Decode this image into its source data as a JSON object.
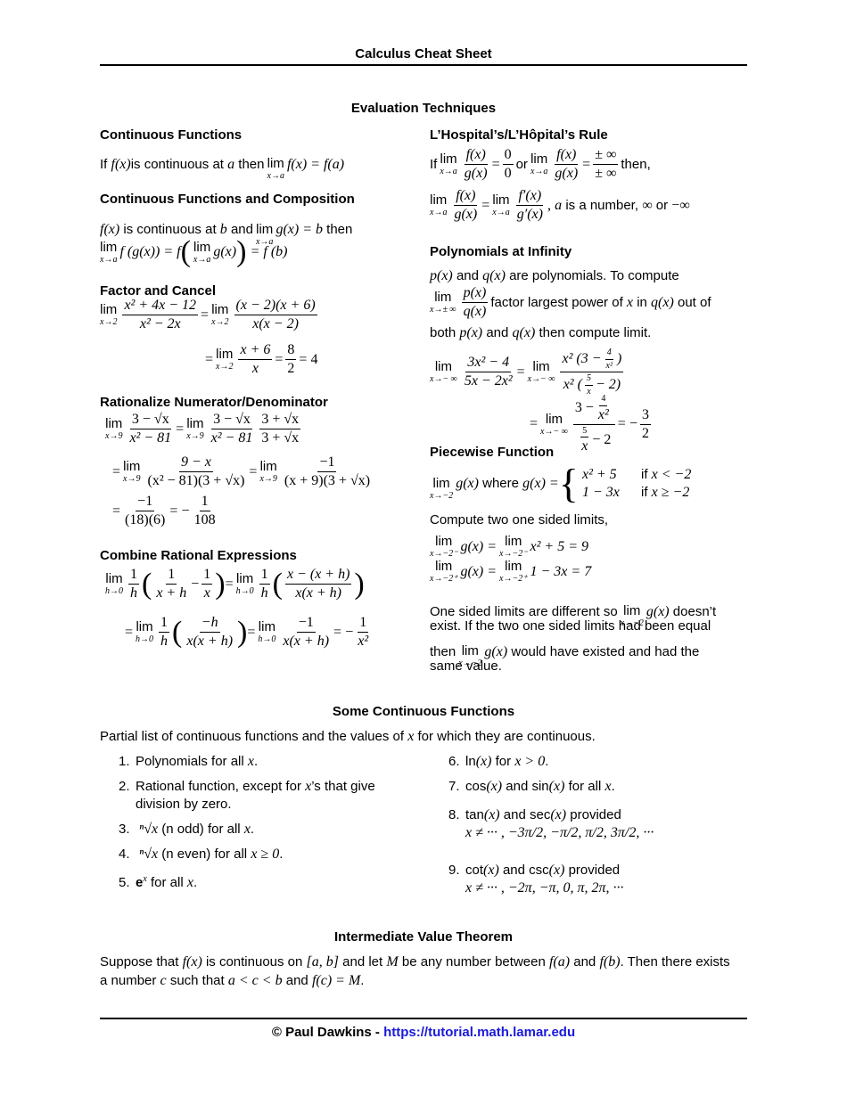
{
  "header": {
    "title": "Calculus Cheat Sheet"
  },
  "section_evaluation": {
    "title": "Evaluation Techniques",
    "continuous_functions": {
      "title": "Continuous Functions",
      "text_if": "If",
      "f_x": "f(x)",
      "text_mid": "is continuous at",
      "a": "a",
      "text_then": "then",
      "lim": "lim",
      "lim_sub": "x→a",
      "expr": "f(x) = f(a)"
    },
    "composition": {
      "title": "Continuous Functions and Composition",
      "f_x": "f(x)",
      "text1": "is continuous at",
      "b": "b",
      "text2": "and",
      "lim": "lim",
      "lim_sub": "x→a",
      "gx_eq_b": "g(x) = b",
      "text3": "then",
      "line2_left": "f (g(x)) = f",
      "line2_inner": "g(x)",
      "line2_right": "= f (b)"
    },
    "factor_cancel": {
      "title": "Factor and Cancel",
      "lim": "lim",
      "lim_sub": "x→2",
      "frac1_num": "x² + 4x − 12",
      "frac1_den": "x² − 2x",
      "frac2_num": "(x − 2)(x + 6)",
      "frac2_den": "x(x − 2)",
      "frac3_num": "x + 6",
      "frac3_den": "x",
      "frac4_num": "8",
      "frac4_den": "2",
      "result": "= 4",
      "eq": "="
    },
    "rationalize": {
      "title": "Rationalize Numerator/Denominator",
      "lim": "lim",
      "lim_sub": "x→9",
      "f1_num": "3 − √x",
      "f1_den": "x² − 81",
      "f2_num": "3 − √x",
      "f2_den": "x² − 81",
      "f3_num": "3 + √x",
      "f3_den": "3 + √x",
      "f4_num": "9 − x",
      "f4_den": "(x² − 81)(3 + √x)",
      "f5_num": "−1",
      "f5_den": "(x + 9)(3 + √x)",
      "f6_num": "−1",
      "f6_den": "(18)(6)",
      "f7_num": "1",
      "f7_den": "108",
      "eq": "=",
      "neg": "−"
    },
    "combine": {
      "title": "Combine Rational Expressions",
      "lim": "lim",
      "lim_sub": "h→0",
      "one": "1",
      "h": "h",
      "f1_num": "1",
      "f1_den": "x + h",
      "f2_num": "1",
      "f2_den": "x",
      "f3_num": "x − (x + h)",
      "f3_den": "x(x + h)",
      "f4_num": "−h",
      "f4_den": "x(x + h)",
      "f5_num": "−1",
      "f5_den": "x(x + h)",
      "f6_num": "1",
      "f6_den": "x²",
      "minus": "−",
      "eq": "="
    },
    "lhospital": {
      "title": "L’Hospital’s/L’Hôpital’s Rule",
      "text_if": "If",
      "lim": "lim",
      "lim_sub": "x→a",
      "fx": "f(x)",
      "gx": "g(x)",
      "zero": "0",
      "text_or": "or",
      "pm_inf": "± ∞",
      "text_then": "then,",
      "fpx": "f′(x)",
      "gpx": "g′(x)",
      "comma": ",",
      "a": "a",
      "text_number": "is a number,",
      "inf": "∞",
      "text_or2": "or",
      "neg_inf": "−∞",
      "eq": "="
    },
    "polynomials": {
      "title": "Polynomials at Infinity",
      "px": "p(x)",
      "qx": "q(x)",
      "text1": "and",
      "text2": "are polynomials. To compute",
      "lim": "lim",
      "lim_sub_pm": "x→± ∞",
      "lim_sub_neg": "x→− ∞",
      "text3": "factor largest power of",
      "x": "x",
      "text4": "in",
      "text5": "out of",
      "text6": "both",
      "text7": "and",
      "text8": "then compute limit.",
      "f1_num": "3x² − 4",
      "f1_den": "5x − 2x²",
      "f2_num_pre": "x² (3 −",
      "f2_num_small_num": "4",
      "f2_num_small_den": "x²",
      "f2_num_post": ")",
      "f2_den_pre": "x² (",
      "f2_den_small_num": "5",
      "f2_den_small_den": "x",
      "f2_den_post": "− 2)",
      "f3_num_pre": "3 −",
      "f3_den_post": "− 2",
      "result_num": "3",
      "result_den": "2",
      "neg": "−",
      "eq": "="
    },
    "piecewise": {
      "title": "Piecewise Function",
      "lim": "lim",
      "lim_sub": "x→−2",
      "gx": "g(x)",
      "text_where": "where",
      "gx_eq": "g(x) =",
      "case1_expr": "x² + 5",
      "case1_cond_if": "if",
      "case1_cond": "x < −2",
      "case2_expr": "1 − 3x",
      "case2_cond_if": "if",
      "case2_cond": "x ≥ −2",
      "compute_text": "Compute two one sided limits,",
      "left_sub": "x→−2⁻",
      "right_sub": "x→−2⁺",
      "left_rhs": "x² + 5 = 9",
      "right_rhs": "1 − 3x = 7",
      "gx_eq2": "g(x) =",
      "conclusion_1a": "One sided limits are different so",
      "conclusion_1b": "doesn’t",
      "conclusion_2": "exist. If the two one sided limits had been equal",
      "conclusion_3a": "then",
      "conclusion_3b": "would have existed and had the",
      "conclusion_4": "same value."
    }
  },
  "section_continuous": {
    "title": "Some Continuous Functions",
    "intro_a": "Partial list of continuous functions and the values of",
    "intro_x": "x",
    "intro_b": "for which they are continuous.",
    "items": [
      {
        "n": "1.",
        "text": "Polynomials for all",
        "math": "x",
        "end": "."
      },
      {
        "n": "2.",
        "text": "Rational function, except for",
        "math": "x",
        "end": "’s that give",
        "line2": "division by zero."
      },
      {
        "n": "3.",
        "math_pre": "ⁿ√x",
        "text": "(n odd) for all",
        "math": "x",
        "end": "."
      },
      {
        "n": "4.",
        "math_pre": "ⁿ√x",
        "text": "(n even) for all",
        "math": "x ≥ 0",
        "end": "."
      },
      {
        "n": "5.",
        "bold": "e",
        "sup": "x",
        "text": "for all",
        "math": "x",
        "end": "."
      },
      {
        "n": "6.",
        "text": "ln",
        "math": "(x)",
        "text2": "for",
        "math2": "x > 0",
        "end": "."
      },
      {
        "n": "7.",
        "text": "cos",
        "math": "(x)",
        "text2": "and sin",
        "math2": "(x)",
        "text3": "for all",
        "math3": "x",
        "end": "."
      },
      {
        "n": "8.",
        "text": "tan",
        "math": "(x)",
        "text2": "and sec",
        "math2": "(x)",
        "text3": "provided",
        "line2": "x ≠ ··· , −3π/2, −π/2, π/2, 3π/2, ···"
      },
      {
        "n": "9.",
        "text": "cot",
        "math": "(x)",
        "text2": "and csc",
        "math2": "(x)",
        "text3": "provided",
        "line2": "x ≠ ··· , −2π, −π, 0, π, 2π, ···"
      }
    ]
  },
  "section_ivt": {
    "title": "Intermediate Value Theorem",
    "line1": [
      {
        "t": "Suppose that "
      },
      {
        "m": "f(x)"
      },
      {
        "t": " is continuous on "
      },
      {
        "m": "[a, b]"
      },
      {
        "t": " and let "
      },
      {
        "m": "M"
      },
      {
        "t": " be any number between "
      },
      {
        "m": "f(a)"
      },
      {
        "t": " and "
      },
      {
        "m": "f(b)"
      },
      {
        "t": ". Then there exists"
      }
    ],
    "line2": [
      {
        "t": "a number "
      },
      {
        "m": "c"
      },
      {
        "t": " such that "
      },
      {
        "m": "a < c < b"
      },
      {
        "t": " and "
      },
      {
        "m": "f(c) = M"
      },
      {
        "t": "."
      }
    ]
  },
  "footer": {
    "copyright": "© Paul Dawkins - ",
    "link": "https://tutorial.math.lamar.edu",
    "link_color": "#1a1adb"
  }
}
